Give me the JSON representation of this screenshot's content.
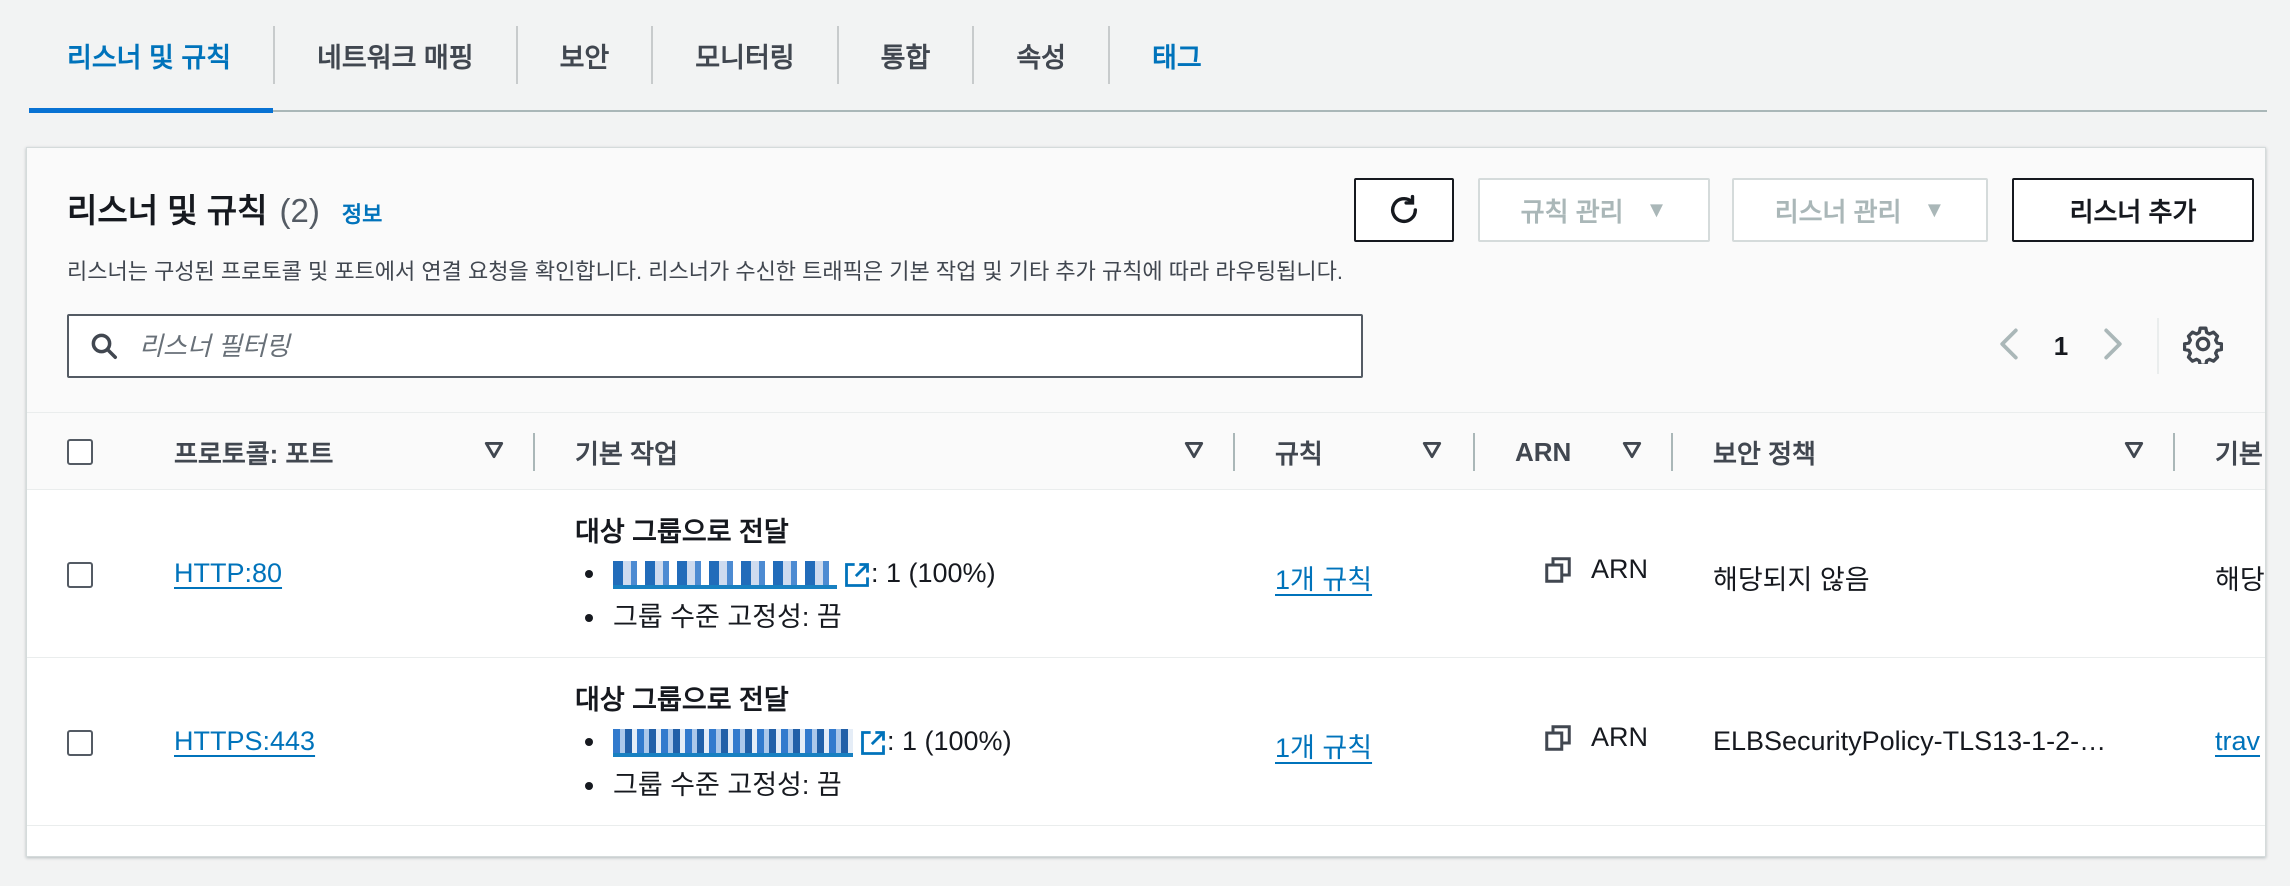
{
  "tabs": [
    {
      "label": "리스너 및 규칙",
      "active": true
    },
    {
      "label": "네트워크 매핑"
    },
    {
      "label": "보안"
    },
    {
      "label": "모니터링"
    },
    {
      "label": "통합"
    },
    {
      "label": "속성"
    },
    {
      "label": "태그"
    }
  ],
  "panel": {
    "title": "리스너 및 규칙",
    "count": "(2)",
    "info_link": "정보",
    "description": "리스너는 구성된 프로토콜 및 포트에서 연결 요청을 확인합니다. 리스너가 수신한 트래픽은 기본 작업 및 기타 추가 규칙에 따라 라우팅됩니다.",
    "buttons": {
      "manage_rules": "규칙 관리",
      "manage_listeners": "리스너 관리",
      "add_listener": "리스너 추가"
    },
    "search_placeholder": "리스너 필터링",
    "page": "1"
  },
  "table": {
    "columns": [
      "프로토콜: 포트",
      "기본 작업",
      "규칙",
      "ARN",
      "보안 정책",
      "기본"
    ],
    "rows": [
      {
        "protocol_port": "HTTP:80",
        "action_title": "대상 그룹으로 전달",
        "target_weight": ": 1 (100%)",
        "stickiness": "그룹 수준 고정성: 끔",
        "rules": "1개 규칙",
        "arn": "ARN",
        "security_policy": "해당되지 않음",
        "default_cert": "해당되"
      },
      {
        "protocol_port": "HTTPS:443",
        "action_title": "대상 그룹으로 전달",
        "target_weight": ": 1 (100%)",
        "stickiness": "그룹 수준 고정성: 끔",
        "rules": "1개 규칙",
        "arn": "ARN",
        "security_policy": "ELBSecurityPolicy-TLS13-1-2-…",
        "default_cert": "trav"
      }
    ]
  },
  "colors": {
    "accent": "#0073bb",
    "active_tab_underline": "#0972d3",
    "page_bg": "#f2f3f3",
    "text": "#16191f",
    "disabled": "#aab7b8"
  },
  "icons": [
    "refresh-icon",
    "caret-down-icon",
    "search-icon",
    "chevron-left-icon",
    "chevron-right-icon",
    "settings-gear-icon",
    "sort-icon",
    "external-link-icon",
    "copy-icon"
  ]
}
